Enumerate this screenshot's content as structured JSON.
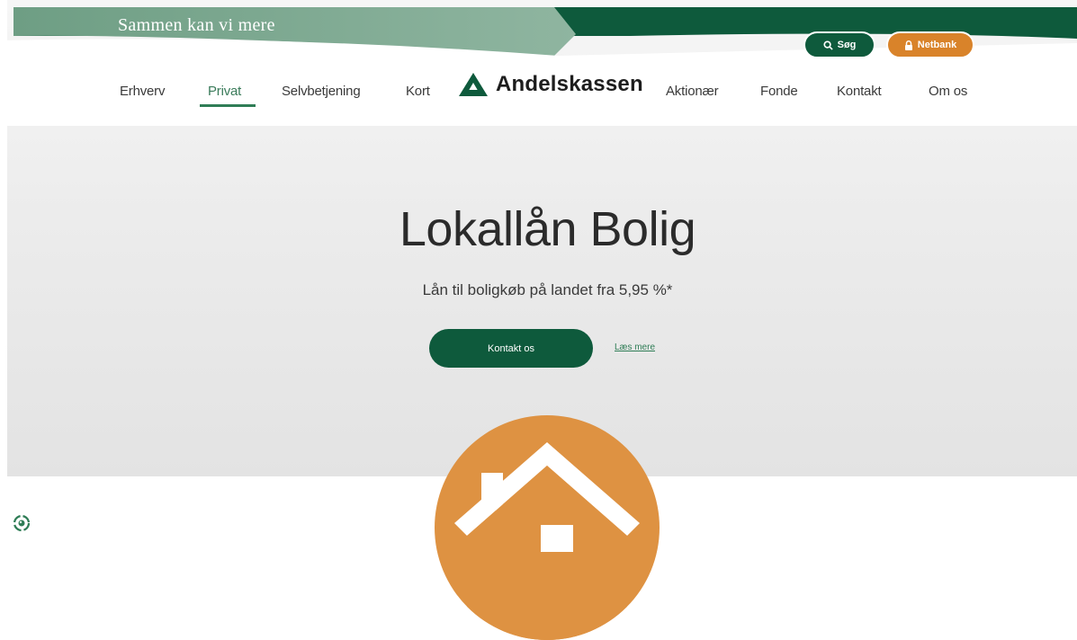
{
  "header": {
    "tagline": "Sammen kan vi mere",
    "search_label": "Søg",
    "netbank_label": "Netbank",
    "colors": {
      "green": "#0e5a3c",
      "banner_light": "#7aa88e",
      "orange": "#d9832a"
    }
  },
  "nav": {
    "logo_text": "Andelskassen",
    "left_items": [
      "Erhverv",
      "Privat",
      "Selvbetjening",
      "Kort"
    ],
    "right_items": [
      "Aktionær",
      "Fonde",
      "Kontakt",
      "Om os"
    ],
    "active_item": "Privat"
  },
  "hero": {
    "title": "Lokallån Bolig",
    "subtitle": "Lån til boligkøb på landet fra 5,95 %*",
    "primary_button": "Kontakt os",
    "secondary_link": "Læs mere",
    "illustration": "house-icon"
  },
  "footer": {
    "cookie_icon": "cookie-settings-icon"
  }
}
